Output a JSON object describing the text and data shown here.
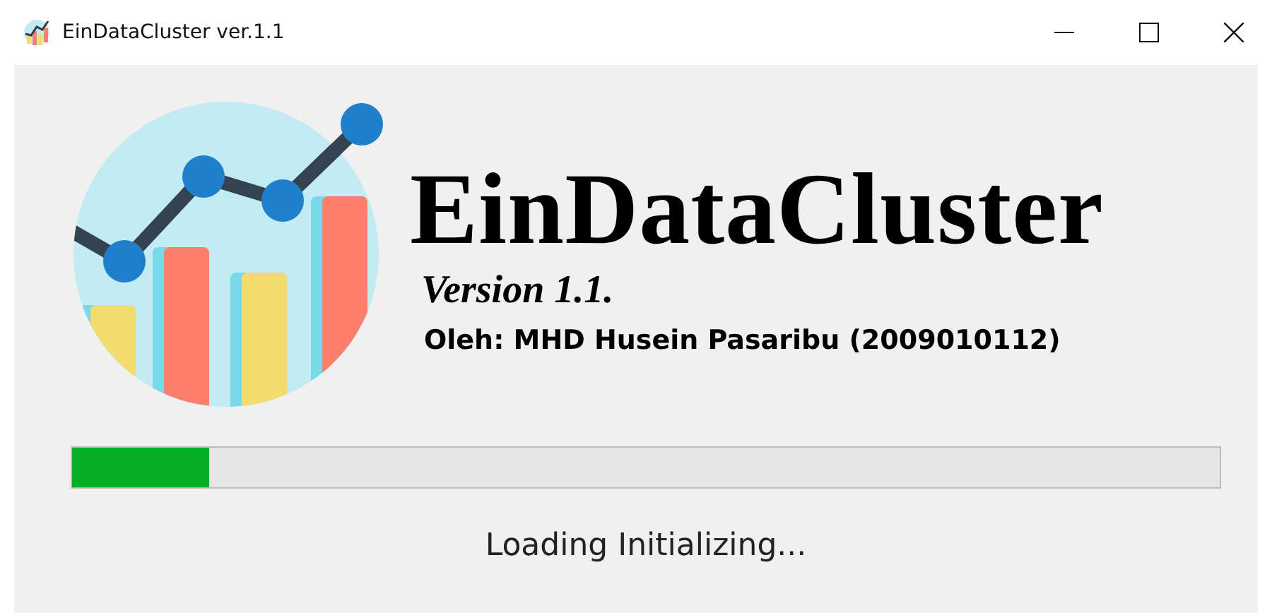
{
  "window": {
    "title": "EinDataCluster ver.1.1"
  },
  "app_title": "EinDataCluster",
  "version": "Version 1.1.",
  "author": "Oleh: MHD Husein Pasaribu (2009010112)",
  "progress": {
    "level": 0.12
  },
  "status": "Loading Initializing..."
}
